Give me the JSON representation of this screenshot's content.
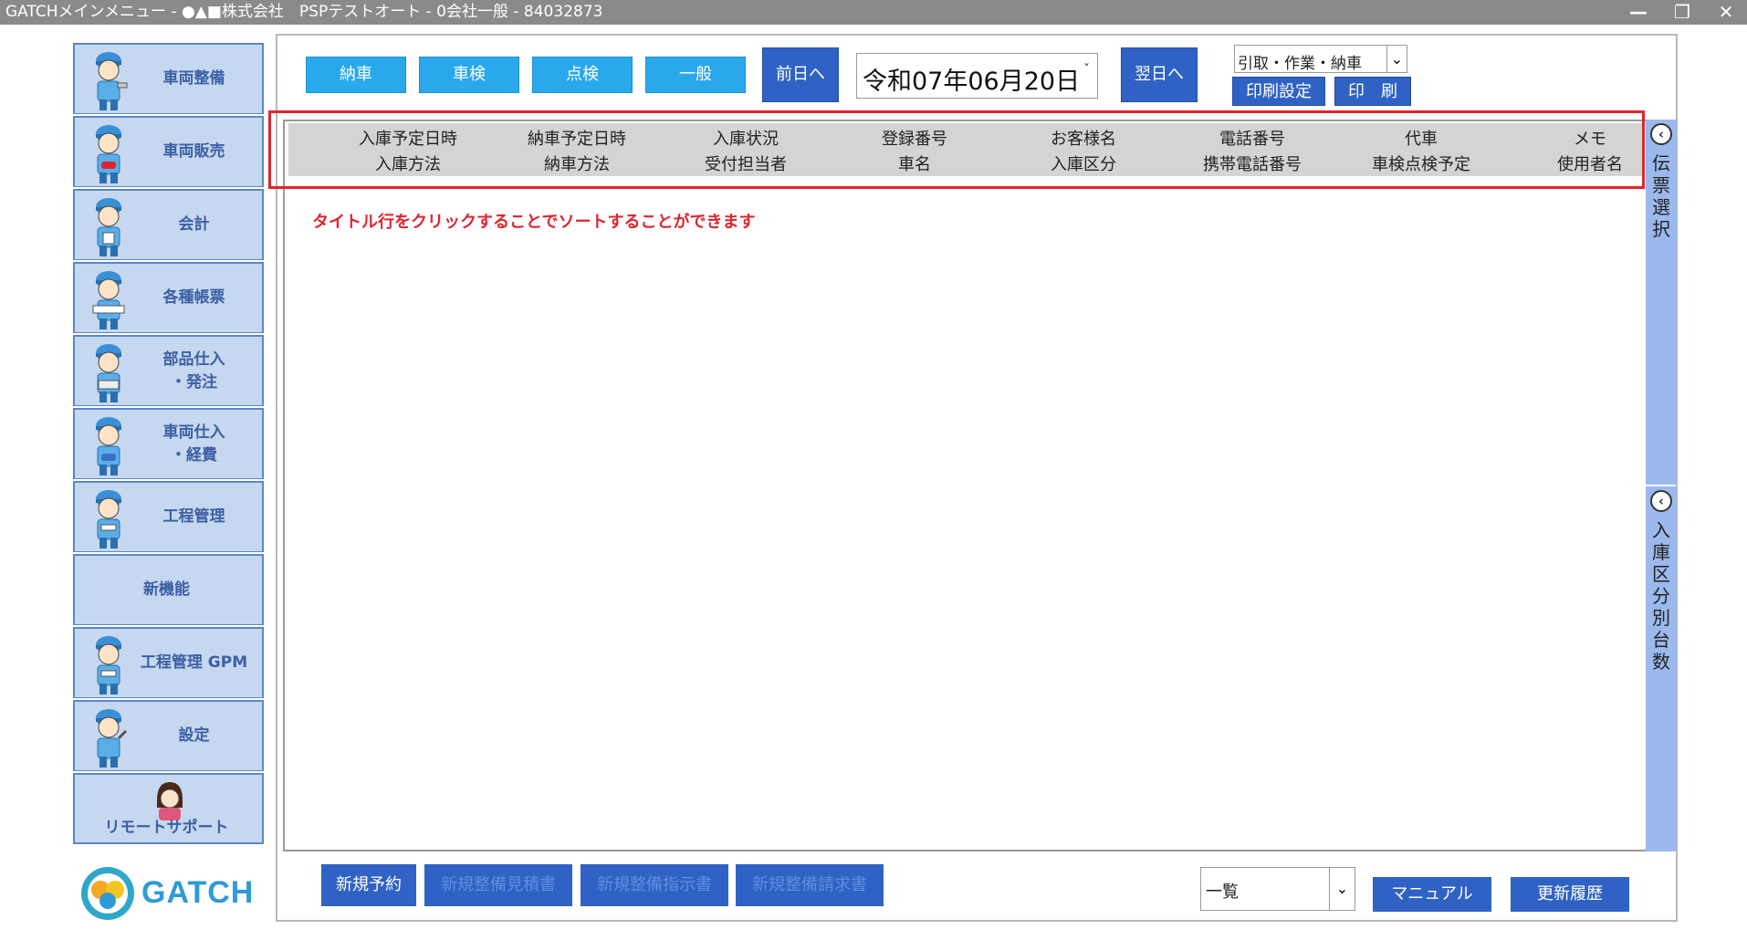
{
  "window": {
    "title": "GATCHメインメニュー - ●▲■株式会社　PSPテストオート - 0会社一般 - 84032873",
    "minimize_icon": "minimize-icon",
    "restore_icon": "restore-icon",
    "close_icon": "close-icon"
  },
  "sidebar": {
    "items": [
      {
        "label": "車両整備"
      },
      {
        "label": "車両販売"
      },
      {
        "label": "会計"
      },
      {
        "label": "各種帳票"
      },
      {
        "label": "部品仕入\n・発注"
      },
      {
        "label": "車両仕入\n・経費"
      },
      {
        "label": "工程管理"
      },
      {
        "label": "新機能"
      },
      {
        "label": "工程管理 GPM"
      },
      {
        "label": "設定"
      },
      {
        "label": "リモートサポート"
      }
    ],
    "logo_text": "GATCH"
  },
  "toolbar": {
    "category_buttons": [
      "納車",
      "車検",
      "点検",
      "一般"
    ],
    "prev_day": "前日へ",
    "date": "令和07年06月20日",
    "next_day": "翌日へ",
    "doc_select": "引取・作業・納車",
    "print_settings": "印刷設定",
    "print": "印　刷"
  },
  "table": {
    "columns": [
      {
        "top": "入庫予定日時",
        "bottom": "入庫方法"
      },
      {
        "top": "納車予定日時",
        "bottom": "納車方法"
      },
      {
        "top": "入庫状況",
        "bottom": "受付担当者"
      },
      {
        "top": "登録番号",
        "bottom": "車名"
      },
      {
        "top": "お客様名",
        "bottom": "入庫区分"
      },
      {
        "top": "電話番号",
        "bottom": "携帯電話番号"
      },
      {
        "top": "代車",
        "bottom": "車検点検予定"
      },
      {
        "top": "メモ",
        "bottom": "使用者名"
      }
    ],
    "sort_note": "タイトル行をクリックすることでソートすることができます"
  },
  "side_tabs": {
    "denpyo": "伝票選択",
    "nyuko": "入庫区分別台数"
  },
  "bottom": {
    "new_reservation": "新規予約",
    "new_estimate": "新規整備見積書",
    "new_instruction": "新規整備指示書",
    "new_invoice": "新規整備請求書",
    "list_select": "一覧",
    "manual": "マニュアル",
    "history": "更新履歴"
  },
  "colors": {
    "accent_blue": "#2f62c4",
    "light_blue": "#29a8ec",
    "highlight_red": "#e0242f",
    "sidebar_bg": "#c6d8ef"
  }
}
